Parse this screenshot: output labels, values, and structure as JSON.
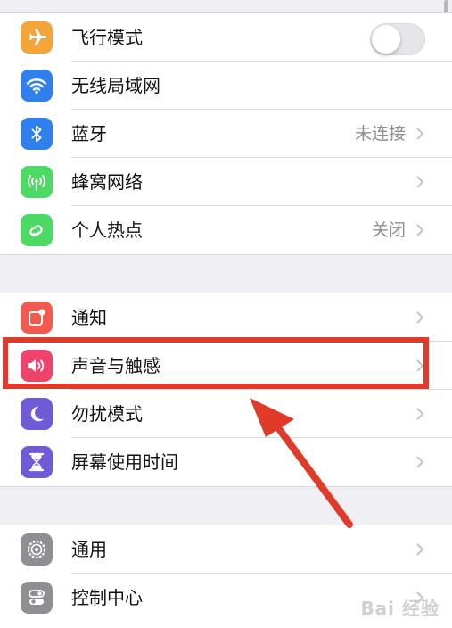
{
  "colors": {
    "airplane": "#f4a53a",
    "wifi": "#2f80ed",
    "bluetooth": "#2f80ed",
    "cellular": "#4cd964",
    "hotspot": "#4cd964",
    "notifications": "#f05a4f",
    "sounds": "#f0436b",
    "dnd": "#6f5bd6",
    "screentime": "#6f5bd6",
    "general": "#8e8e93",
    "controlcenter": "#8e8e93",
    "highlight": "#e03a2a"
  },
  "settings": {
    "group1": [
      {
        "label": "飞行模式",
        "icon": "airplane-icon",
        "toggle_on": false
      },
      {
        "label": "无线局域网",
        "icon": "wifi-icon"
      },
      {
        "label": "蓝牙",
        "icon": "bluetooth-icon",
        "value": "未连接"
      },
      {
        "label": "蜂窝网络",
        "icon": "cellular-icon"
      },
      {
        "label": "个人热点",
        "icon": "hotspot-icon",
        "value": "关闭"
      }
    ],
    "group2": [
      {
        "label": "通知",
        "icon": "notifications-icon"
      },
      {
        "label": "声音与触感",
        "icon": "speaker-icon"
      },
      {
        "label": "勿扰模式",
        "icon": "moon-icon"
      },
      {
        "label": "屏幕使用时间",
        "icon": "hourglass-icon"
      }
    ],
    "group3": [
      {
        "label": "通用",
        "icon": "gear-icon"
      },
      {
        "label": "控制中心",
        "icon": "toggles-icon"
      }
    ]
  },
  "watermark": "Bai 经验"
}
